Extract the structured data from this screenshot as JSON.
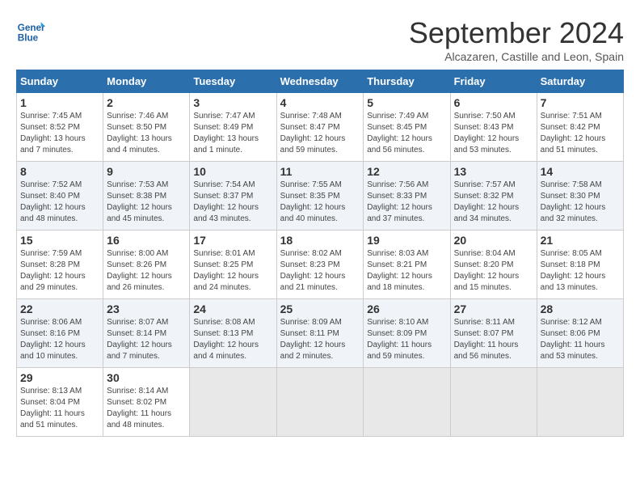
{
  "logo": {
    "line1": "General",
    "line2": "Blue"
  },
  "title": "September 2024",
  "subtitle": "Alcazaren, Castille and Leon, Spain",
  "days_of_week": [
    "Sunday",
    "Monday",
    "Tuesday",
    "Wednesday",
    "Thursday",
    "Friday",
    "Saturday"
  ],
  "weeks": [
    [
      {
        "num": "1",
        "info": "Sunrise: 7:45 AM\nSunset: 8:52 PM\nDaylight: 13 hours\nand 7 minutes."
      },
      {
        "num": "2",
        "info": "Sunrise: 7:46 AM\nSunset: 8:50 PM\nDaylight: 13 hours\nand 4 minutes."
      },
      {
        "num": "3",
        "info": "Sunrise: 7:47 AM\nSunset: 8:49 PM\nDaylight: 13 hours\nand 1 minute."
      },
      {
        "num": "4",
        "info": "Sunrise: 7:48 AM\nSunset: 8:47 PM\nDaylight: 12 hours\nand 59 minutes."
      },
      {
        "num": "5",
        "info": "Sunrise: 7:49 AM\nSunset: 8:45 PM\nDaylight: 12 hours\nand 56 minutes."
      },
      {
        "num": "6",
        "info": "Sunrise: 7:50 AM\nSunset: 8:43 PM\nDaylight: 12 hours\nand 53 minutes."
      },
      {
        "num": "7",
        "info": "Sunrise: 7:51 AM\nSunset: 8:42 PM\nDaylight: 12 hours\nand 51 minutes."
      }
    ],
    [
      {
        "num": "8",
        "info": "Sunrise: 7:52 AM\nSunset: 8:40 PM\nDaylight: 12 hours\nand 48 minutes."
      },
      {
        "num": "9",
        "info": "Sunrise: 7:53 AM\nSunset: 8:38 PM\nDaylight: 12 hours\nand 45 minutes."
      },
      {
        "num": "10",
        "info": "Sunrise: 7:54 AM\nSunset: 8:37 PM\nDaylight: 12 hours\nand 43 minutes."
      },
      {
        "num": "11",
        "info": "Sunrise: 7:55 AM\nSunset: 8:35 PM\nDaylight: 12 hours\nand 40 minutes."
      },
      {
        "num": "12",
        "info": "Sunrise: 7:56 AM\nSunset: 8:33 PM\nDaylight: 12 hours\nand 37 minutes."
      },
      {
        "num": "13",
        "info": "Sunrise: 7:57 AM\nSunset: 8:32 PM\nDaylight: 12 hours\nand 34 minutes."
      },
      {
        "num": "14",
        "info": "Sunrise: 7:58 AM\nSunset: 8:30 PM\nDaylight: 12 hours\nand 32 minutes."
      }
    ],
    [
      {
        "num": "15",
        "info": "Sunrise: 7:59 AM\nSunset: 8:28 PM\nDaylight: 12 hours\nand 29 minutes."
      },
      {
        "num": "16",
        "info": "Sunrise: 8:00 AM\nSunset: 8:26 PM\nDaylight: 12 hours\nand 26 minutes."
      },
      {
        "num": "17",
        "info": "Sunrise: 8:01 AM\nSunset: 8:25 PM\nDaylight: 12 hours\nand 24 minutes."
      },
      {
        "num": "18",
        "info": "Sunrise: 8:02 AM\nSunset: 8:23 PM\nDaylight: 12 hours\nand 21 minutes."
      },
      {
        "num": "19",
        "info": "Sunrise: 8:03 AM\nSunset: 8:21 PM\nDaylight: 12 hours\nand 18 minutes."
      },
      {
        "num": "20",
        "info": "Sunrise: 8:04 AM\nSunset: 8:20 PM\nDaylight: 12 hours\nand 15 minutes."
      },
      {
        "num": "21",
        "info": "Sunrise: 8:05 AM\nSunset: 8:18 PM\nDaylight: 12 hours\nand 13 minutes."
      }
    ],
    [
      {
        "num": "22",
        "info": "Sunrise: 8:06 AM\nSunset: 8:16 PM\nDaylight: 12 hours\nand 10 minutes."
      },
      {
        "num": "23",
        "info": "Sunrise: 8:07 AM\nSunset: 8:14 PM\nDaylight: 12 hours\nand 7 minutes."
      },
      {
        "num": "24",
        "info": "Sunrise: 8:08 AM\nSunset: 8:13 PM\nDaylight: 12 hours\nand 4 minutes."
      },
      {
        "num": "25",
        "info": "Sunrise: 8:09 AM\nSunset: 8:11 PM\nDaylight: 12 hours\nand 2 minutes."
      },
      {
        "num": "26",
        "info": "Sunrise: 8:10 AM\nSunset: 8:09 PM\nDaylight: 11 hours\nand 59 minutes."
      },
      {
        "num": "27",
        "info": "Sunrise: 8:11 AM\nSunset: 8:07 PM\nDaylight: 11 hours\nand 56 minutes."
      },
      {
        "num": "28",
        "info": "Sunrise: 8:12 AM\nSunset: 8:06 PM\nDaylight: 11 hours\nand 53 minutes."
      }
    ],
    [
      {
        "num": "29",
        "info": "Sunrise: 8:13 AM\nSunset: 8:04 PM\nDaylight: 11 hours\nand 51 minutes."
      },
      {
        "num": "30",
        "info": "Sunrise: 8:14 AM\nSunset: 8:02 PM\nDaylight: 11 hours\nand 48 minutes."
      },
      {
        "num": "",
        "info": ""
      },
      {
        "num": "",
        "info": ""
      },
      {
        "num": "",
        "info": ""
      },
      {
        "num": "",
        "info": ""
      },
      {
        "num": "",
        "info": ""
      }
    ]
  ]
}
